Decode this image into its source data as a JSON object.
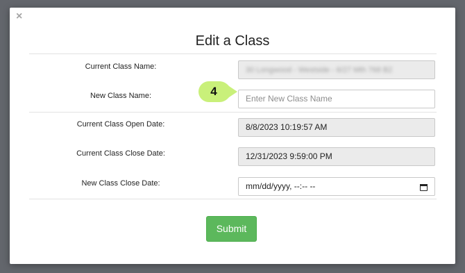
{
  "dialog": {
    "title": "Edit a Class",
    "close_icon": "close-icon",
    "fields": [
      {
        "label": "Current Class Name:",
        "value": "30 Longwood - Westside - 6/27 Mth 768 B2",
        "readonly": true,
        "blurred": true
      },
      {
        "label": "New Class Name:",
        "value": "",
        "placeholder": "Enter New Class Name",
        "readonly": false
      },
      {
        "label": "Current Class Open Date:",
        "value": "8/8/2023 10:19:57 AM",
        "readonly": true
      },
      {
        "label": "Current Class Close Date:",
        "value": "12/31/2023 9:59:00 PM",
        "readonly": true
      },
      {
        "label": "New Class Close Date:",
        "value": "mm/dd/yyyy, --:-- --",
        "readonly": false,
        "icon": "calendar-icon"
      }
    ],
    "submit_label": "Submit"
  },
  "annotation": {
    "step": "4",
    "color": "#c9f07a"
  },
  "colors": {
    "submit": "#5cb85c",
    "readonly_bg": "#ebebeb",
    "overlay": "#63666c"
  }
}
